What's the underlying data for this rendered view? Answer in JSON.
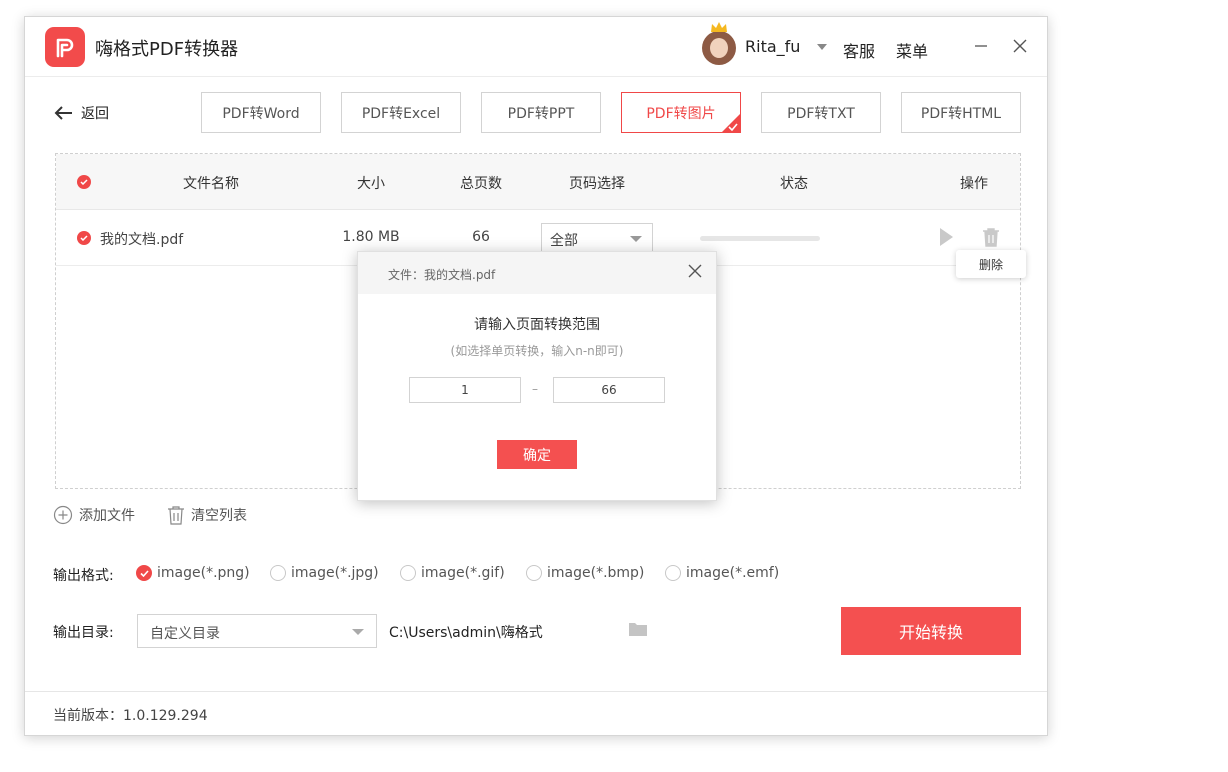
{
  "app": {
    "title": "嗨格式PDF转换器",
    "username": "Rita_fu",
    "service_label": "客服",
    "menu_label": "菜单"
  },
  "toolbar": {
    "back_label": "返回",
    "tabs": [
      {
        "label": "PDF转Word",
        "active": false
      },
      {
        "label": "PDF转Excel",
        "active": false
      },
      {
        "label": "PDF转PPT",
        "active": false
      },
      {
        "label": "PDF转图片",
        "active": true
      },
      {
        "label": "PDF转TXT",
        "active": false
      },
      {
        "label": "PDF转HTML",
        "active": false
      }
    ]
  },
  "table": {
    "headers": {
      "name": "文件名称",
      "size": "大小",
      "pages": "总页数",
      "page_select": "页码选择",
      "status": "状态",
      "actions": "操作"
    },
    "rows": [
      {
        "name": "我的文档.pdf",
        "size": "1.80 MB",
        "pages": "66",
        "page_select": "全部",
        "progress": 0
      }
    ],
    "delete_tooltip": "删除"
  },
  "list_actions": {
    "add_label": "添加文件",
    "clear_label": "清空列表"
  },
  "output": {
    "format_label": "输出格式:",
    "formats": [
      {
        "label": "image(*.png)",
        "selected": true
      },
      {
        "label": "image(*.jpg)",
        "selected": false
      },
      {
        "label": "image(*.gif)",
        "selected": false
      },
      {
        "label": "image(*.bmp)",
        "selected": false
      },
      {
        "label": "image(*.emf)",
        "selected": false
      }
    ],
    "dir_label": "输出目录:",
    "dir_mode": "自定义目录",
    "dir_path": "C:\\Users\\admin\\嗨格式",
    "start_label": "开始转换"
  },
  "footer": {
    "version_text": "当前版本：1.0.129.294"
  },
  "dialog": {
    "title": "文件：我的文档.pdf",
    "heading": "请输入页面转换范围",
    "hint": "(如选择单页转换，输入n-n即可)",
    "range_start": "1",
    "range_end": "66",
    "separator": "–",
    "confirm_label": "确定"
  },
  "colors": {
    "accent": "#f04848",
    "button": "#f45050"
  }
}
